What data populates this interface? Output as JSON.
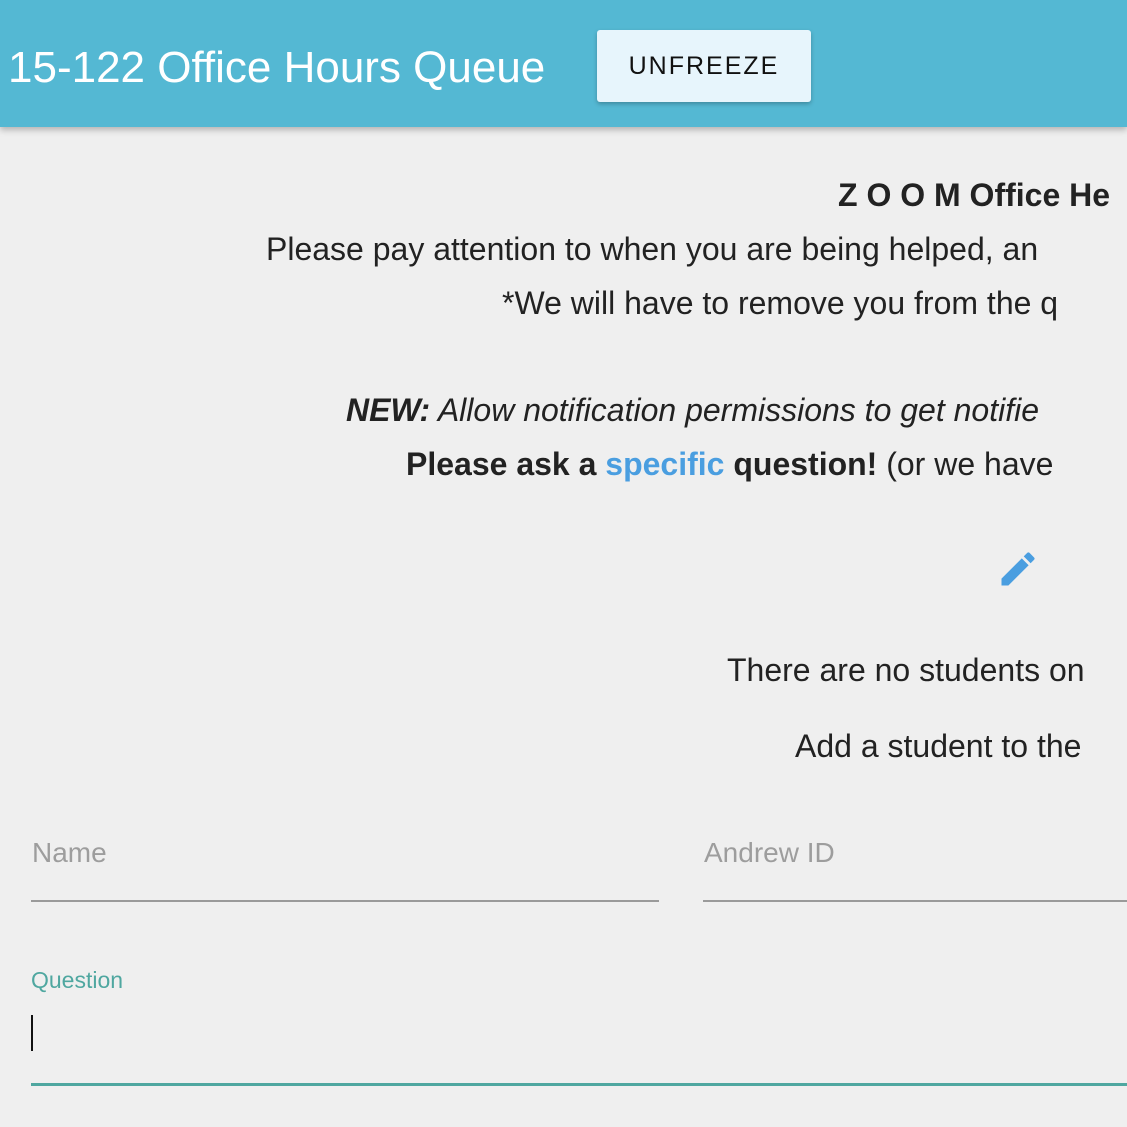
{
  "header": {
    "title": "15-122 Office Hours Queue",
    "unfreeze_label": "UNFREEZE",
    "background": "#54b8d3"
  },
  "announcement": {
    "zoom_title": "Z O O M Office He",
    "notice_line_1": "Please pay attention to when you are being helped, an",
    "notice_line_2": "*We will have to remove you from the q",
    "new_label": "NEW:",
    "new_text": " Allow notification permissions to get notifie",
    "ask_prefix": "Please ask a ",
    "ask_highlight": "specific",
    "ask_suffix": " question!",
    "ask_tail": " (or we have",
    "accent_color": "#4a9ee0"
  },
  "edit_icon": "pencil-icon",
  "queue": {
    "empty_message": "There are no students on",
    "add_message": "Add a student to the"
  },
  "form": {
    "name_placeholder": "Name",
    "andrew_id_placeholder": "Andrew ID",
    "question_label": "Question",
    "question_value": "",
    "focus_color": "#4fa7a0"
  }
}
